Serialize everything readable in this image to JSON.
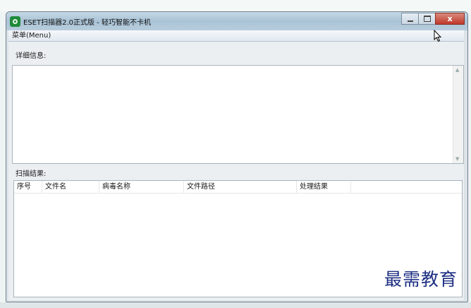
{
  "window": {
    "title": "ESET扫描器2.0正式版 - 轻巧智能不卡机",
    "icon": "eset-app-icon",
    "close_glyph": "x"
  },
  "menu": {
    "label": "菜单(Menu)"
  },
  "detail": {
    "label": "详细信息:"
  },
  "results": {
    "label": "扫描结果:",
    "columns": [
      "序号",
      "文件名",
      "病毒名称",
      "文件路径",
      "处理结果"
    ],
    "rows": []
  },
  "watermark": "最需教育",
  "colors": {
    "title_accent": "#a9c3d6",
    "close_button": "#c0392b",
    "watermark": "#1d2f83"
  }
}
